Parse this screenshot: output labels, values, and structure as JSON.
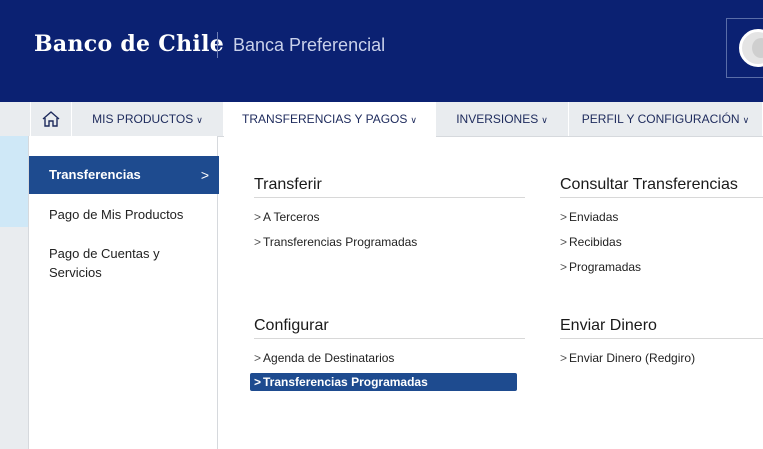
{
  "header": {
    "brand": "Banco de Chile",
    "subtitle": "Banca Preferencial"
  },
  "nav": {
    "items": [
      {
        "label": "MIS PRODUCTOS"
      },
      {
        "label": "TRANSFERENCIAS Y PAGOS"
      },
      {
        "label": "INVERSIONES"
      },
      {
        "label": "PERFIL Y CONFIGURACIÓN"
      }
    ],
    "active_index": 1
  },
  "sidebar": {
    "items": [
      {
        "label": "Transferencias"
      },
      {
        "label": "Pago de Mis Productos"
      },
      {
        "label": "Pago de Cuentas y Servicios"
      }
    ]
  },
  "sections": {
    "transferir": {
      "title": "Transferir",
      "links": [
        "A Terceros",
        "Transferencias Programadas"
      ]
    },
    "consultar": {
      "title": "Consultar Transferencias",
      "links": [
        "Enviadas",
        "Recibidas",
        "Programadas"
      ]
    },
    "configurar": {
      "title": "Configurar",
      "links": [
        "Agenda de Destinatarios",
        "Transferencias Programadas"
      ]
    },
    "enviar": {
      "title": "Enviar Dinero",
      "links": [
        "Enviar Dinero (Redgiro)"
      ]
    }
  },
  "icons": {
    "home": "home-icon",
    "chevron": "chevron-down-icon",
    "arrow": "chevron-right-icon"
  },
  "colors": {
    "header_bg": "#0b2172",
    "active_blue": "#1e4b8f",
    "nav_bg": "#e9ecef"
  }
}
